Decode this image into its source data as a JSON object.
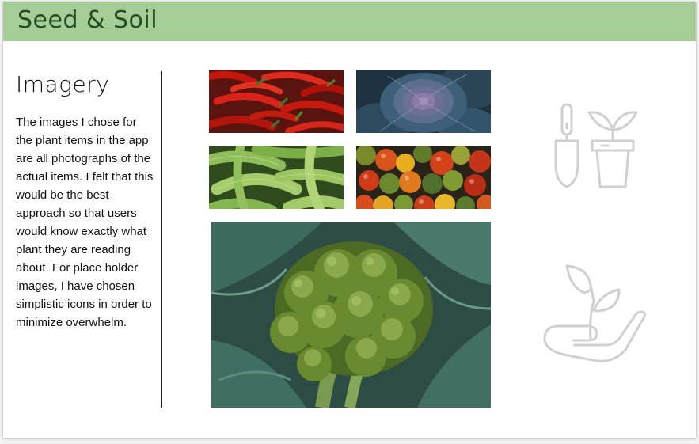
{
  "header": {
    "brand": "Seed & Soil",
    "bg_color": "#a5cd98",
    "text_color": "#274b22"
  },
  "section": {
    "title": "Imagery",
    "body": "The images I chose for the plant items in the app are all photographs of the actual items. I felt that this would be the best approach so that users would know exactly what plant they are reading about. For place holder images, I have chosen simplistic icons in order to minimize overwhelm."
  },
  "gallery": [
    {
      "name": "red-chili-peppers-photo",
      "subject": "red chili peppers"
    },
    {
      "name": "purple-ornamental-cabbage-photo",
      "subject": "ornamental kale"
    },
    {
      "name": "okra-photo",
      "subject": "okra"
    },
    {
      "name": "heirloom-tomatoes-photo",
      "subject": "cherry tomatoes"
    },
    {
      "name": "broccoli-photo",
      "subject": "broccoli"
    }
  ],
  "placeholder_icons": [
    {
      "name": "trowel-and-potted-plant-icon"
    },
    {
      "name": "seedling-in-hand-icon"
    }
  ],
  "icon_color": "#d0d0d0"
}
